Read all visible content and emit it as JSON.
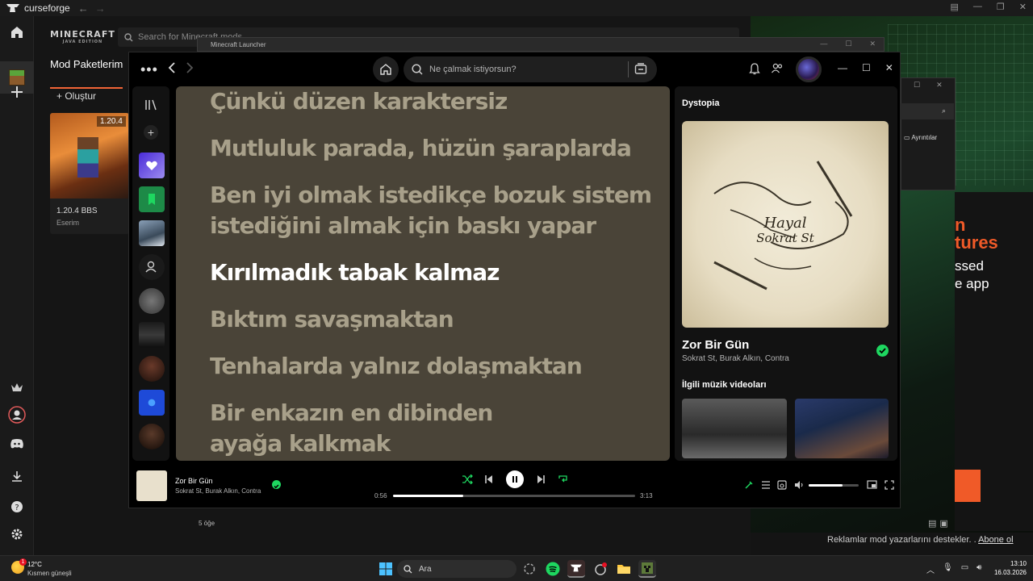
{
  "curseforge": {
    "app_name": "curseforge",
    "search_placeholder": "Search for Minecraft mods...",
    "game_logo": "MINECRAFT",
    "game_logo_sub": "JAVA EDITION",
    "tab_label": "Mod Paketlerim",
    "create_label": "Oluştur",
    "card": {
      "version": "1.20.4",
      "title": "1.20.4 BBS",
      "subtitle": "Eserim"
    },
    "item_count": "5 öğe",
    "ad_notice": "Reklamlar mod yazarlarını destekler. .",
    "ad_link": "Abone ol",
    "launcher_title": "Minecraft Launcher",
    "aux_label": "Ayrıntılar"
  },
  "ad": {
    "line1": "n",
    "line2": "tures",
    "line3": "ssed",
    "line4": "e app",
    "accent": "#f05a28"
  },
  "spotify": {
    "search_placeholder": "Ne çalmak istiyorsun?",
    "lyrics": [
      {
        "text": "Çünkü düzen karaktersiz",
        "active": false
      },
      {
        "text": "Mutluluk parada, hüzün şaraplarda",
        "active": false
      },
      {
        "text": "Ben iyi olmak istedikçe bozuk sistem",
        "active": false
      },
      {
        "text": "istediğini almak için baskı yapar",
        "active": false
      },
      {
        "text": "Kırılmadık tabak kalmaz",
        "active": true
      },
      {
        "text": "Bıktım savaşmaktan",
        "active": false
      },
      {
        "text": "Tenhalarda yalnız dolaşmaktan",
        "active": false
      },
      {
        "text": "Bir enkazın en dibinden",
        "active": false
      },
      {
        "text": "ayağa kalkmak",
        "active": false
      }
    ],
    "right_panel": {
      "playlist_title": "Dystopia",
      "cover_text_1": "Hayal",
      "cover_text_2": "Sokrat St",
      "track_title": "Zor Bir Gün",
      "artists": "Sokrat St, Burak Alkın, Contra",
      "videos_title": "İlgili müzik videoları"
    },
    "now_playing": {
      "title": "Zor Bir Gün",
      "artists": "Sokrat St, Burak Alkın, Contra",
      "elapsed": "0:56",
      "duration": "3:13",
      "progress_fraction": 0.29,
      "volume_fraction": 0.68
    },
    "accent": "#1ed760"
  },
  "taskbar": {
    "temp": "12°C",
    "weather": "Kısmen güneşli",
    "weather_badge": "1",
    "search_label": "Ara",
    "time": "13:10",
    "date": "16.03.2026"
  }
}
